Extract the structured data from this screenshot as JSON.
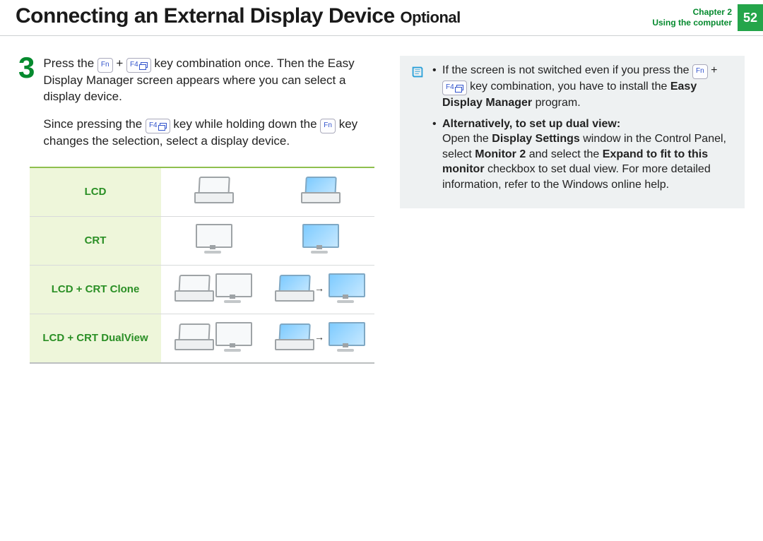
{
  "header": {
    "title_main": "Connecting an External Display Device",
    "title_suffix": "Optional",
    "chapter_line1": "Chapter 2",
    "chapter_line2": "Using the computer",
    "page_number": "52"
  },
  "step": {
    "number": "3",
    "p1_a": "Press the ",
    "p1_b": " + ",
    "p1_c": " key combination once. Then the Easy Display Manager screen appears where you can select a display device.",
    "p2_a": "Since pressing the ",
    "p2_b": " key while holding down the ",
    "p2_c": " key changes the selection, select a display device."
  },
  "keys": {
    "fn": "Fn",
    "f4": "F4"
  },
  "table": {
    "rows": [
      {
        "label": "LCD"
      },
      {
        "label": "CRT"
      },
      {
        "label": "LCD + CRT Clone"
      },
      {
        "label": "LCD + CRT DualView"
      }
    ]
  },
  "note": {
    "item1_a": "If the screen is not switched even if you press the ",
    "item1_b": " + ",
    "item1_c": " key combination, you have to install the ",
    "item1_d": "Easy Display Manager",
    "item1_e": " program.",
    "item2_heading": "Alternatively, to set up dual view:",
    "item2_a": "Open the ",
    "item2_b": "Display Settings",
    "item2_c": " window in the Control Panel, select ",
    "item2_d": "Monitor 2",
    "item2_e": " and select the ",
    "item2_f": "Expand to fit to this monitor",
    "item2_g": " checkbox to set dual view. For more detailed information, refer to the Windows online help."
  }
}
